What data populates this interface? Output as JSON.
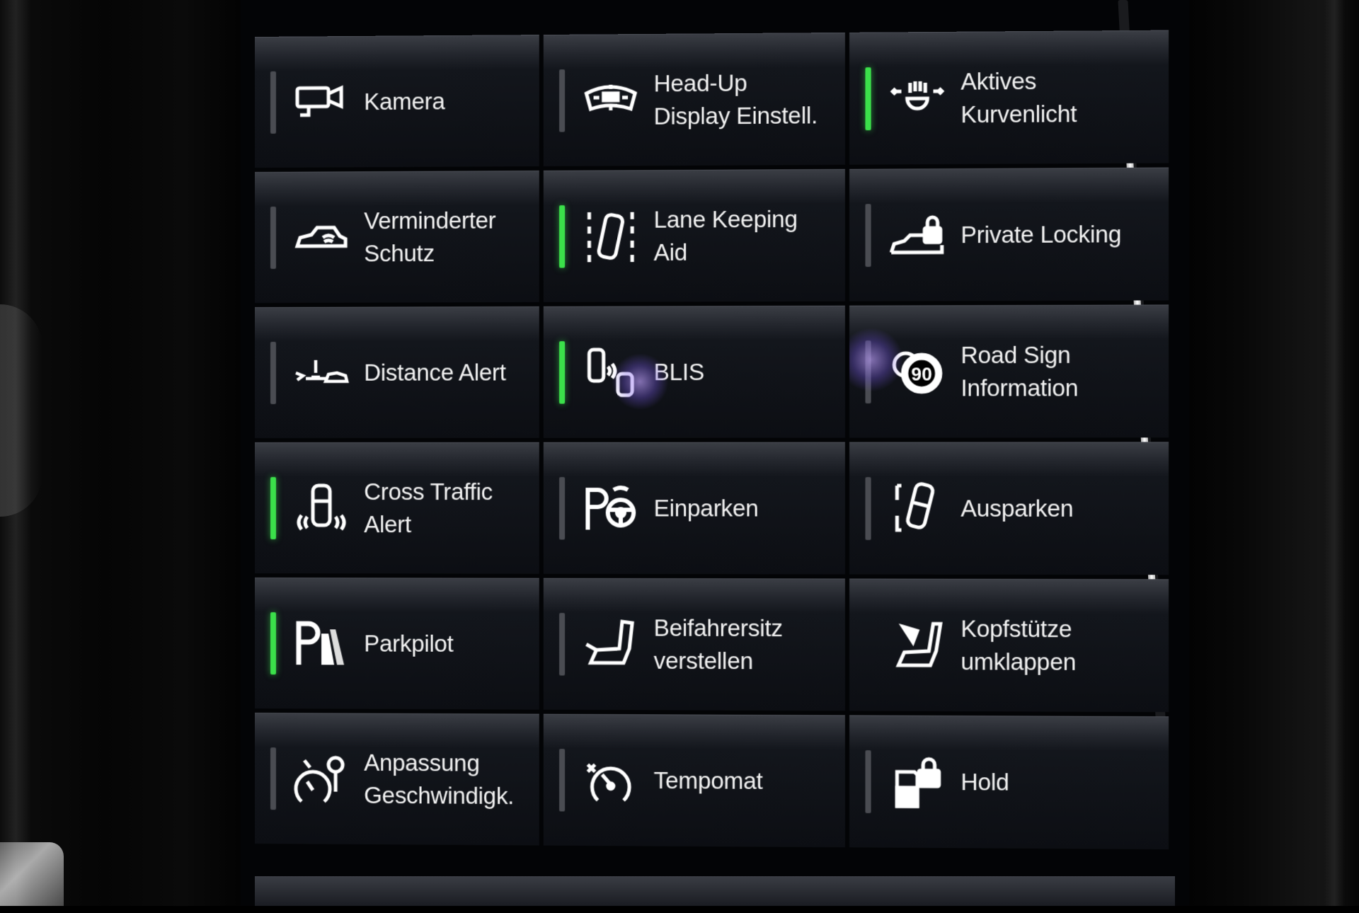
{
  "tiles": [
    {
      "label": "Kamera",
      "icon": "camera-icon",
      "status": "none"
    },
    {
      "label": "Head-Up\nDisplay Einstell.",
      "icon": "head-up-display-icon",
      "status": "none"
    },
    {
      "label": "Aktives\nKurvenlicht",
      "icon": "active-bending-light-icon",
      "status": "on"
    },
    {
      "label": "Verminderter\nSchutz",
      "icon": "reduced-guard-icon",
      "status": "off"
    },
    {
      "label": "Lane Keeping\nAid",
      "icon": "lane-keeping-aid-icon",
      "status": "on"
    },
    {
      "label": "Private Locking",
      "icon": "private-locking-icon",
      "status": "off"
    },
    {
      "label": "Distance Alert",
      "icon": "distance-alert-icon",
      "status": "off"
    },
    {
      "label": "BLIS",
      "icon": "blis-icon",
      "status": "on"
    },
    {
      "label": "Road Sign\nInformation",
      "icon": "road-sign-information-icon",
      "status": "off"
    },
    {
      "label": "Cross Traffic\nAlert",
      "icon": "cross-traffic-alert-icon",
      "status": "on"
    },
    {
      "label": "Einparken",
      "icon": "park-in-icon",
      "status": "off"
    },
    {
      "label": "Ausparken",
      "icon": "park-out-icon",
      "status": "off"
    },
    {
      "label": "Parkpilot",
      "icon": "park-assist-icon",
      "status": "on"
    },
    {
      "label": "Beifahrersitz\nverstellen",
      "icon": "passenger-seat-icon",
      "status": "off"
    },
    {
      "label": "Kopfstütze\numklappen",
      "icon": "headrest-fold-icon",
      "status": "none"
    },
    {
      "label": "Anpassung\nGeschwindigk.",
      "icon": "speed-adaptation-icon",
      "status": "off"
    },
    {
      "label": "Tempomat",
      "icon": "cruise-control-icon",
      "status": "off"
    },
    {
      "label": "Hold",
      "icon": "hold-icon",
      "status": "off"
    }
  ],
  "colors": {
    "active": "#3be04a",
    "inactive": "#4a4c52",
    "text": "#f2f2f2"
  }
}
